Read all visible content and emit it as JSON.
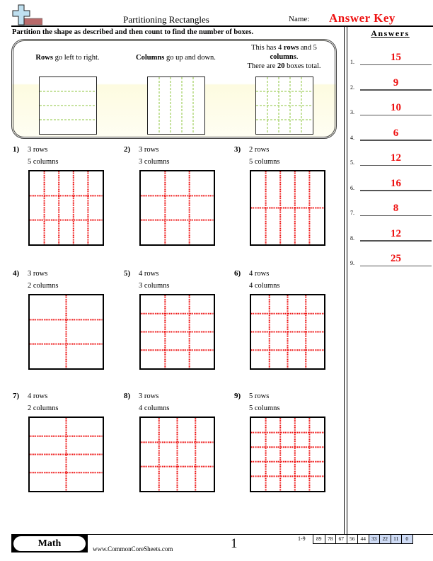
{
  "header": {
    "title": "Partitioning Rectangles",
    "name_label": "Name:",
    "name_value": "Answer Key"
  },
  "instructions": "Partition the shape as described and then count to find the number of boxes.",
  "examples": [
    {
      "text_html": "<b>Rows</b> go left to right.",
      "rows": 4,
      "cols": 1
    },
    {
      "text_html": "<b>Columns</b> go up and down.",
      "rows": 1,
      "cols": 5
    },
    {
      "text_html": "This has 4 <b>rows</b> and 5<br><b>columns</b>.<br>There are <b>20</b> boxes total.",
      "rows": 4,
      "cols": 5
    }
  ],
  "example_line_color": "#8cc43c",
  "problems": [
    {
      "num": "1)",
      "rows_label": "3 rows",
      "cols_label": "5 columns",
      "rows": 3,
      "cols": 5
    },
    {
      "num": "2)",
      "rows_label": "3 rows",
      "cols_label": "3 columns",
      "rows": 3,
      "cols": 3
    },
    {
      "num": "3)",
      "rows_label": "2 rows",
      "cols_label": "5 columns",
      "rows": 2,
      "cols": 5
    },
    {
      "num": "4)",
      "rows_label": "3 rows",
      "cols_label": "2 columns",
      "rows": 3,
      "cols": 2
    },
    {
      "num": "5)",
      "rows_label": "4 rows",
      "cols_label": "3 columns",
      "rows": 4,
      "cols": 3
    },
    {
      "num": "6)",
      "rows_label": "4 rows",
      "cols_label": "4 columns",
      "rows": 4,
      "cols": 4
    },
    {
      "num": "7)",
      "rows_label": "4 rows",
      "cols_label": "2 columns",
      "rows": 4,
      "cols": 2
    },
    {
      "num": "8)",
      "rows_label": "3 rows",
      "cols_label": "4 columns",
      "rows": 3,
      "cols": 4
    },
    {
      "num": "9)",
      "rows_label": "5 rows",
      "cols_label": "5 columns",
      "rows": 5,
      "cols": 5
    }
  ],
  "partition_line_color": "#ee1111",
  "answers": {
    "title": "Answers",
    "items": [
      {
        "num": "1.",
        "value": "15"
      },
      {
        "num": "2.",
        "value": "9"
      },
      {
        "num": "3.",
        "value": "10"
      },
      {
        "num": "4.",
        "value": "6"
      },
      {
        "num": "5.",
        "value": "12"
      },
      {
        "num": "6.",
        "value": "16"
      },
      {
        "num": "7.",
        "value": "8"
      },
      {
        "num": "8.",
        "value": "12"
      },
      {
        "num": "9.",
        "value": "25"
      }
    ]
  },
  "footer": {
    "subject": "Math",
    "website": "www.CommonCoreSheets.com",
    "page": "1",
    "range": "1-9",
    "scores": [
      "89",
      "78",
      "67",
      "56",
      "44",
      "33",
      "22",
      "11",
      "0"
    ],
    "shaded_from_index": 5
  }
}
